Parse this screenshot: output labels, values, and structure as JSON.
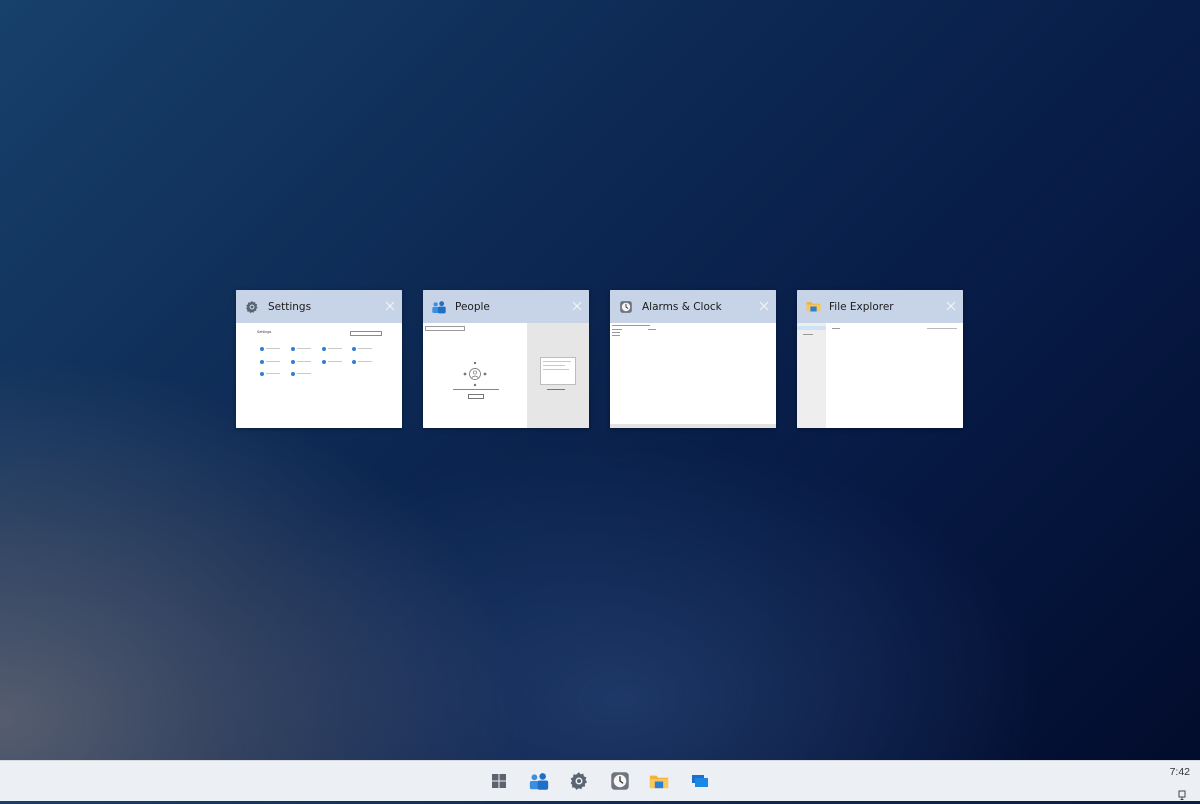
{
  "task_view": {
    "windows": [
      {
        "title": "Settings",
        "icon": "gear-icon",
        "thumb_title": "Settings"
      },
      {
        "title": "People",
        "icon": "people-icon"
      },
      {
        "title": "Alarms & Clock",
        "icon": "clock-icon"
      },
      {
        "title": "File Explorer",
        "icon": "folder-icon"
      }
    ]
  },
  "taskbar": {
    "icons": [
      "windows-start-icon",
      "people-icon",
      "gear-icon",
      "clock-icon",
      "folder-icon",
      "task-view-icon"
    ],
    "clock": "7:42"
  },
  "colors": {
    "card_header": "#c7d3e7",
    "taskbar": "#eceff3",
    "accent": "#2f7fd3"
  }
}
